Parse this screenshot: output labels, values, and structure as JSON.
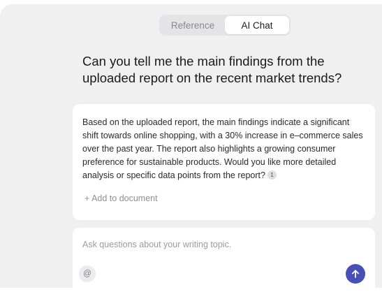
{
  "tabs": [
    {
      "label": "Reference",
      "active": false
    },
    {
      "label": "AI Chat",
      "active": true
    }
  ],
  "question": "Can you tell me the main findings from the uploaded report on the recent market trends?",
  "answer": {
    "text": "Based on the uploaded report, the main findings indicate a significant shift towards online shopping, with a 30% increase in e–commerce sales over the past year. The report also highlights a growing consumer preference for sustainable products. Would you like more detailed analysis or specific data points from the report?",
    "citation": "1",
    "add_to_document": "+ Add to document"
  },
  "composer": {
    "placeholder": "Ask questions about your writing topic.",
    "at_label": "@",
    "send_icon": "arrow-up-icon",
    "send_color": "#4a4fb8"
  }
}
